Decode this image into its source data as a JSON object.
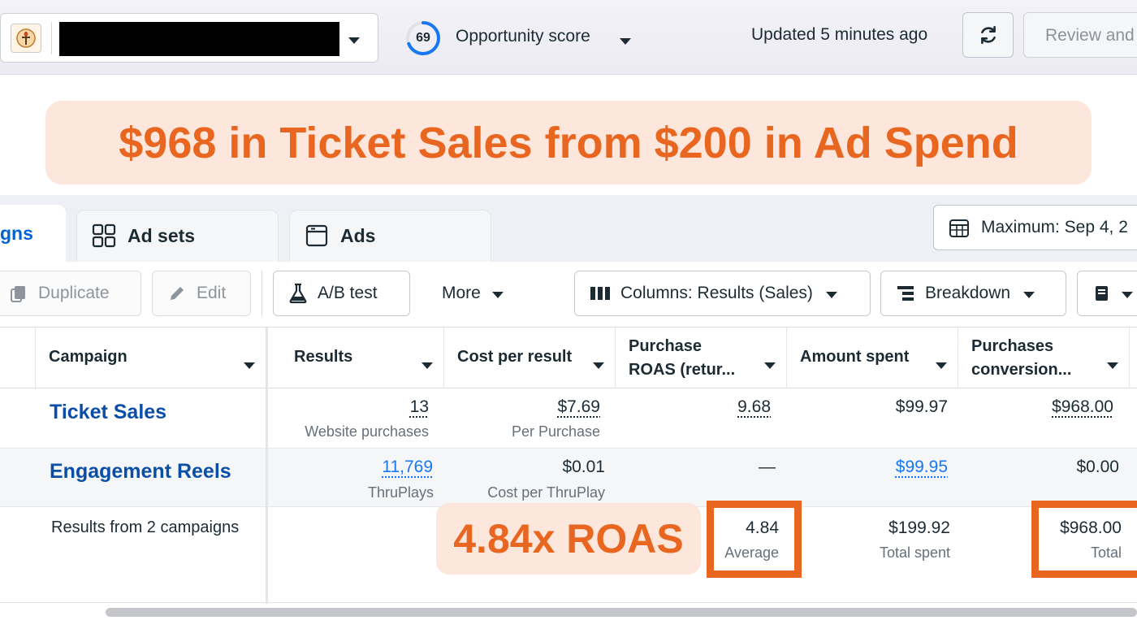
{
  "topbar": {
    "score": "69",
    "score_fraction": 0.69,
    "opportunity_label": "Opportunity score",
    "updated": "Updated 5 minutes ago",
    "review_label": "Review and"
  },
  "headline": "$968 in Ticket Sales from $200 in Ad Spend",
  "tabs": [
    {
      "label": "gns",
      "active": true
    },
    {
      "label": "Ad sets",
      "active": false
    },
    {
      "label": "Ads",
      "active": false
    }
  ],
  "date_range": "Maximum: Sep 4, 2",
  "toolbar": {
    "duplicate": "Duplicate",
    "edit": "Edit",
    "ab_test": "A/B test",
    "more": "More",
    "columns": "Columns: Results (Sales)",
    "breakdown": "Breakdown"
  },
  "table": {
    "headers": {
      "campaign": "Campaign",
      "results": "Results",
      "cost_per_result": "Cost per result",
      "roas_line1": "Purchase",
      "roas_line2": "ROAS (retur...",
      "amount_spent": "Amount spent",
      "conv_line1": "Purchases",
      "conv_line2": "conversion..."
    },
    "rows": [
      {
        "name": "Ticket Sales",
        "results": "13",
        "results_sub": "Website purchases",
        "cost": "$7.69",
        "cost_sub": "Per Purchase",
        "roas": "9.68",
        "spent": "$99.97",
        "conv": "$968.00"
      },
      {
        "name": "Engagement Reels",
        "results": "11,769",
        "results_sub": "ThruPlays",
        "cost": "$0.01",
        "cost_sub": "Cost per ThruPlay",
        "roas": "—",
        "spent": "$99.95",
        "conv": "$0.00"
      }
    ],
    "summary": {
      "label": "Results from 2 campaigns",
      "roas": "4.84",
      "roas_sub": "Average",
      "spent": "$199.92",
      "spent_sub": "Total spent",
      "conv": "$968.00",
      "conv_sub": "Total"
    }
  },
  "roas_callout": "4.84x ROAS",
  "accent_color": "#e8661f",
  "link_color": "#0a4ea8"
}
